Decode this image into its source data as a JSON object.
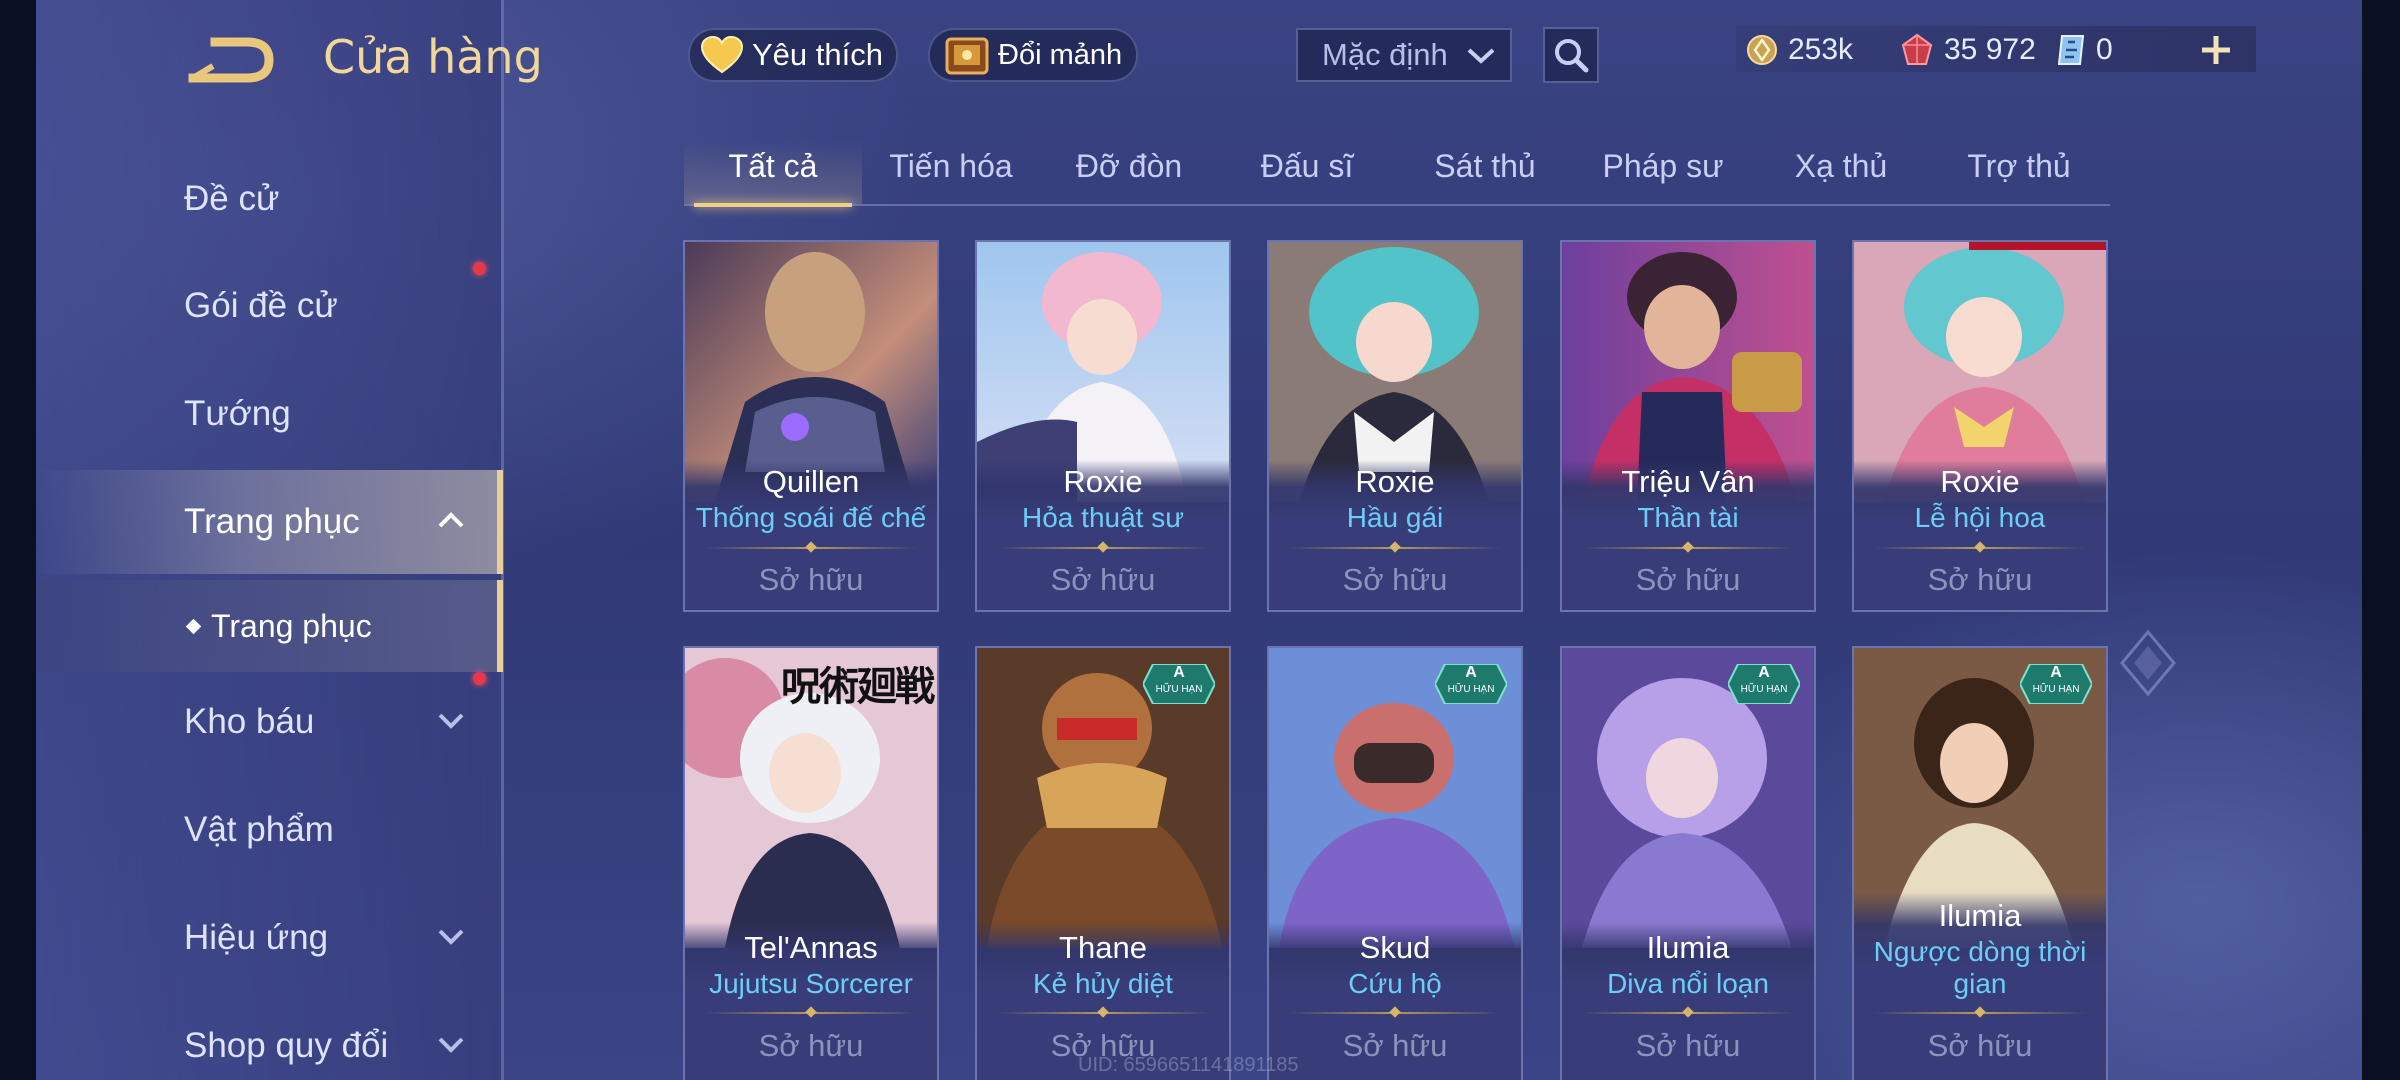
{
  "header": {
    "title": "Cửa hàng",
    "favorites_label": "Yêu thích",
    "exchange_label": "Đổi mảnh",
    "sort_value": "Mặc định"
  },
  "currency": {
    "gold": "253k",
    "vouchers": "35 972",
    "tickets": "0"
  },
  "sidebar": {
    "items": [
      {
        "label": "Đề cử"
      },
      {
        "label": "Gói đề cử"
      },
      {
        "label": "Tướng"
      },
      {
        "label": "Trang phục"
      },
      {
        "label": "Kho báu"
      },
      {
        "label": "Vật phẩm"
      },
      {
        "label": "Hiệu ứng"
      },
      {
        "label": "Shop quy đổi"
      }
    ],
    "sub_item": "Trang phục"
  },
  "tabs": [
    "Tất cả",
    "Tiến hóa",
    "Đỡ đòn",
    "Đấu sĩ",
    "Sát thủ",
    "Pháp sư",
    "Xạ thủ",
    "Trợ thủ"
  ],
  "active_tab": "Tất cả",
  "cards": [
    {
      "hero": "Quillen",
      "skin": "Thống soái đế chế",
      "status": "Sở hữu"
    },
    {
      "hero": "Roxie",
      "skin": "Hỏa thuật sư",
      "status": "Sở hữu"
    },
    {
      "hero": "Roxie",
      "skin": "Hầu gái",
      "status": "Sở hữu"
    },
    {
      "hero": "Triệu Vân",
      "skin": "Thần tài",
      "status": "Sở hữu"
    },
    {
      "hero": "Roxie",
      "skin": "Lễ hội hoa",
      "status": "Sở hữu"
    },
    {
      "hero": "Tel'Annas",
      "skin": "Jujutsu Sorcerer",
      "status": "Sở hữu",
      "art_text": "呪術廻戦"
    },
    {
      "hero": "Thane",
      "skin": "Kẻ hủy diệt",
      "status": "Sở hữu",
      "badge": {
        "grade": "A",
        "label": "HỮU HẠN"
      }
    },
    {
      "hero": "Skud",
      "skin": "Cứu hộ",
      "status": "Sở hữu",
      "badge": {
        "grade": "A",
        "label": "HỮU HẠN"
      }
    },
    {
      "hero": "Ilumia",
      "skin": "Diva nổi loạn",
      "status": "Sở hữu",
      "badge": {
        "grade": "A",
        "label": "HỮU HẠN"
      }
    },
    {
      "hero": "Ilumia",
      "skin": "Ngược dòng thời gian",
      "status": "Sở hữu",
      "badge": {
        "grade": "A",
        "label": "HỮU HẠN"
      }
    }
  ],
  "uid": "UID: 6596651141891185",
  "colors": {
    "accent_gold": "#f1cf86",
    "skin_name": "#6ccdf6",
    "notification": "#e5384b"
  }
}
